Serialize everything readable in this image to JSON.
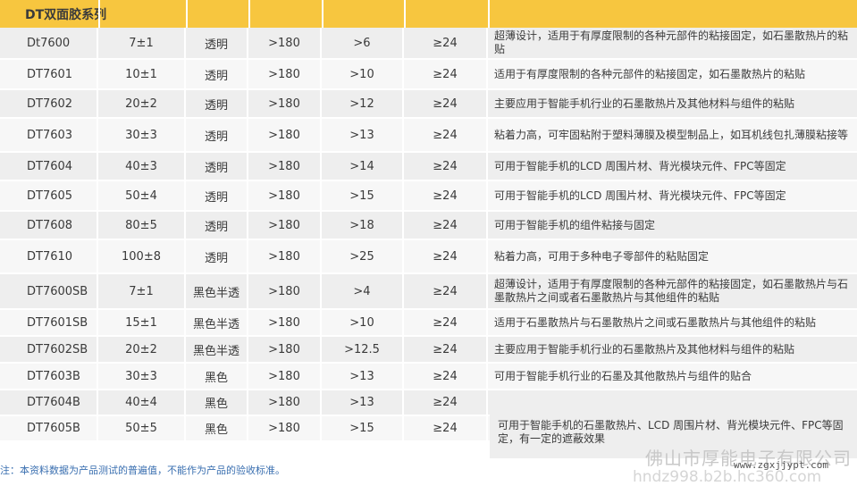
{
  "header": {
    "title": "DT双面胶系列"
  },
  "rows": [
    {
      "model": "Dt7600",
      "thickness": "7±1",
      "color": "透明",
      "temp": ">180",
      "peel": ">6",
      "hold": "≥24",
      "use": "超薄设计，适用于有厚度限制的各种元部件的粘接固定，如石墨散热片的粘贴"
    },
    {
      "model": "DT7601",
      "thickness": "10±1",
      "color": "透明",
      "temp": ">180",
      "peel": ">10",
      "hold": "≥24",
      "use": "适用于有厚度限制的各种元部件的粘接固定，如石墨散热片的粘贴"
    },
    {
      "model": "DT7602",
      "thickness": "20±2",
      "color": "透明",
      "temp": ">180",
      "peel": ">12",
      "hold": "≥24",
      "use": "主要应用于智能手机行业的石墨散热片及其他材料与组件的粘贴"
    },
    {
      "model": "DT7603",
      "thickness": "30±3",
      "color": "透明",
      "temp": ">180",
      "peel": ">13",
      "hold": "≥24",
      "use": "粘着力高，可牢固粘附于塑料薄膜及模型制品上，如耳机线包扎薄膜粘接等"
    },
    {
      "model": "DT7604",
      "thickness": "40±3",
      "color": "透明",
      "temp": ">180",
      "peel": ">14",
      "hold": "≥24",
      "use": "可用于智能手机的LCD 周围片材、背光模块元件、FPC等固定"
    },
    {
      "model": "DT7605",
      "thickness": "50±4",
      "color": "透明",
      "temp": ">180",
      "peel": ">15",
      "hold": "≥24",
      "use": "可用于智能手机的LCD 周围片材、背光模块元件、FPC等固定"
    },
    {
      "model": "DT7608",
      "thickness": "80±5",
      "color": "透明",
      "temp": ">180",
      "peel": ">18",
      "hold": "≥24",
      "use": "可用于智能手机的组件粘接与固定"
    },
    {
      "model": "DT7610",
      "thickness": "100±8",
      "color": "透明",
      "temp": ">180",
      "peel": ">25",
      "hold": "≥24",
      "use": "粘着力高，可用于多种电子零部件的粘贴固定"
    },
    {
      "model": "DT7600SB",
      "thickness": "7±1",
      "color": "黑色半透",
      "temp": ">180",
      "peel": ">4",
      "hold": "≥24",
      "use": "超薄设计，适用于有厚度限制的各种元部件的粘接固定，如石墨散热片与石墨散热片之间或者石墨散热片与其他组件的粘贴"
    },
    {
      "model": "DT7601SB",
      "thickness": "15±1",
      "color": "黑色半透",
      "temp": ">180",
      "peel": ">10",
      "hold": "≥24",
      "use": "适用于石墨散热片与石墨散热片之间或石墨散热片与其他组件的粘贴"
    },
    {
      "model": "DT7602SB",
      "thickness": "20±2",
      "color": "黑色半透",
      "temp": ">180",
      "peel": ">12.5",
      "hold": "≥24",
      "use": "主要应用于智能手机行业的石墨散热片及其他材料与组件的粘贴"
    },
    {
      "model": "DT7603B",
      "thickness": "30±3",
      "color": "黑色",
      "temp": ">180",
      "peel": ">13",
      "hold": "≥24",
      "use": "可用于智能手机行业的石墨及其他散热片与组件的贴合"
    },
    {
      "model": "DT7604B",
      "thickness": "40±4",
      "color": "黑色",
      "temp": ">180",
      "peel": ">13",
      "hold": "≥24",
      "use": ""
    },
    {
      "model": "DT7605B",
      "thickness": "50±5",
      "color": "黑色",
      "temp": ">180",
      "peel": ">15",
      "hold": "≥24",
      "use": ""
    }
  ],
  "merged_use": "可用于智能手机的石墨散热片、LCD 周围片材、背光模块元件、FPC等固定，有一定的遮蔽效果",
  "note": "注：本资料数据为产品测试的普遍值，不能作为产品的验收标准。",
  "watermark": {
    "company": "佛山市厚能电子有限公司",
    "site": "www.zgxjjypt.com",
    "url": "hndz998.b2b.hc360.com"
  }
}
